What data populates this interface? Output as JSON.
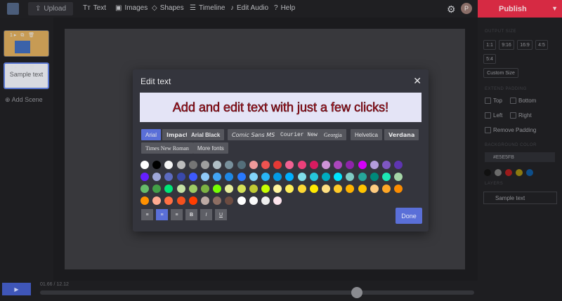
{
  "toolbar": {
    "upload_label": "Upload",
    "nav": [
      {
        "label": "Text",
        "icon": "text-icon"
      },
      {
        "label": "Images",
        "icon": "image-icon"
      },
      {
        "label": "Shapes",
        "icon": "shapes-icon"
      },
      {
        "label": "Timeline",
        "icon": "timeline-icon"
      },
      {
        "label": "Edit Audio",
        "icon": "music-icon"
      },
      {
        "label": "Help",
        "icon": "help-icon"
      }
    ],
    "avatar_initial": "P",
    "publish_label": "Publish"
  },
  "scenes": [
    {
      "label": ""
    },
    {
      "label": "Sample text"
    }
  ],
  "add_scene_label": "Add Scene",
  "right_panel": {
    "ratio_options": [
      "1:1",
      "9:16",
      "16:9",
      "4:5",
      "5:4"
    ],
    "custom_size_label": "Custom Size",
    "padding_options": [
      "Top",
      "Bottom",
      "Left",
      "Right",
      "Remove Padding"
    ],
    "background_hex": "#E5E5FB",
    "layer_label": "Sample text"
  },
  "timeline": {
    "play_label": "▶",
    "time_text": "01.66 / 12.12"
  },
  "modal": {
    "title": "Edit text",
    "preview_text": "Add and edit text with just a few clicks!",
    "fonts": [
      "Arial",
      "Impact",
      "Arial Black",
      "Comic Sans MS",
      "Courier New",
      "Georgia",
      "Helvetica",
      "Verdana",
      "Times New Roman",
      "More fonts"
    ],
    "active_font": "Arial",
    "done_label": "Done",
    "align_buttons": [
      "align-left",
      "align-center",
      "align-right",
      "bold",
      "italic",
      "underline"
    ],
    "active_align": "align-center",
    "colors": [
      "#ffffff",
      "#000000",
      "#f5f5f5",
      "#bdbdbd",
      "#757575",
      "#9e9e9e",
      "#b0bec5",
      "#78909c",
      "#546e7a",
      "#ef9a9a",
      "#ef5350",
      "#e53935",
      "#f06292",
      "#ec407a",
      "#d81b60",
      "#ce93d8",
      "#ab47bc",
      "#8e24aa",
      "#d500f9",
      "#b39ddb",
      "#7e57c2",
      "#5e35b1",
      "#651fff",
      "#9fa8da",
      "#5c6bc0",
      "#3949ab",
      "#3d5afe",
      "#90caf9",
      "#42a5f5",
      "#1e88e5",
      "#2979ff",
      "#81d4fa",
      "#29b6f6",
      "#039be5",
      "#00b0ff",
      "#80deea",
      "#26c6da",
      "#00acc1",
      "#00e5ff",
      "#80cbc4",
      "#26a69a",
      "#00897b",
      "#1de9b6",
      "#a5d6a7",
      "#66bb6a",
      "#43a047",
      "#00e676",
      "#c5e1a5",
      "#9ccc65",
      "#7cb342",
      "#76ff03",
      "#e6ee9c",
      "#d4e157",
      "#c0ca33",
      "#c6ff00",
      "#fff59d",
      "#ffee58",
      "#fdd835",
      "#ffea00",
      "#ffe082",
      "#ffca28",
      "#ffb300",
      "#ffc400",
      "#ffcc80",
      "#ffa726",
      "#fb8c00",
      "#ff9100",
      "#ffab91",
      "#ff7043",
      "#f4511e",
      "#ff3d00",
      "#bcaaa4",
      "#8d6e63",
      "#6d4c41",
      "#ffffff",
      "#fafafa",
      "#eeeeee",
      "#fce4ec"
    ]
  }
}
